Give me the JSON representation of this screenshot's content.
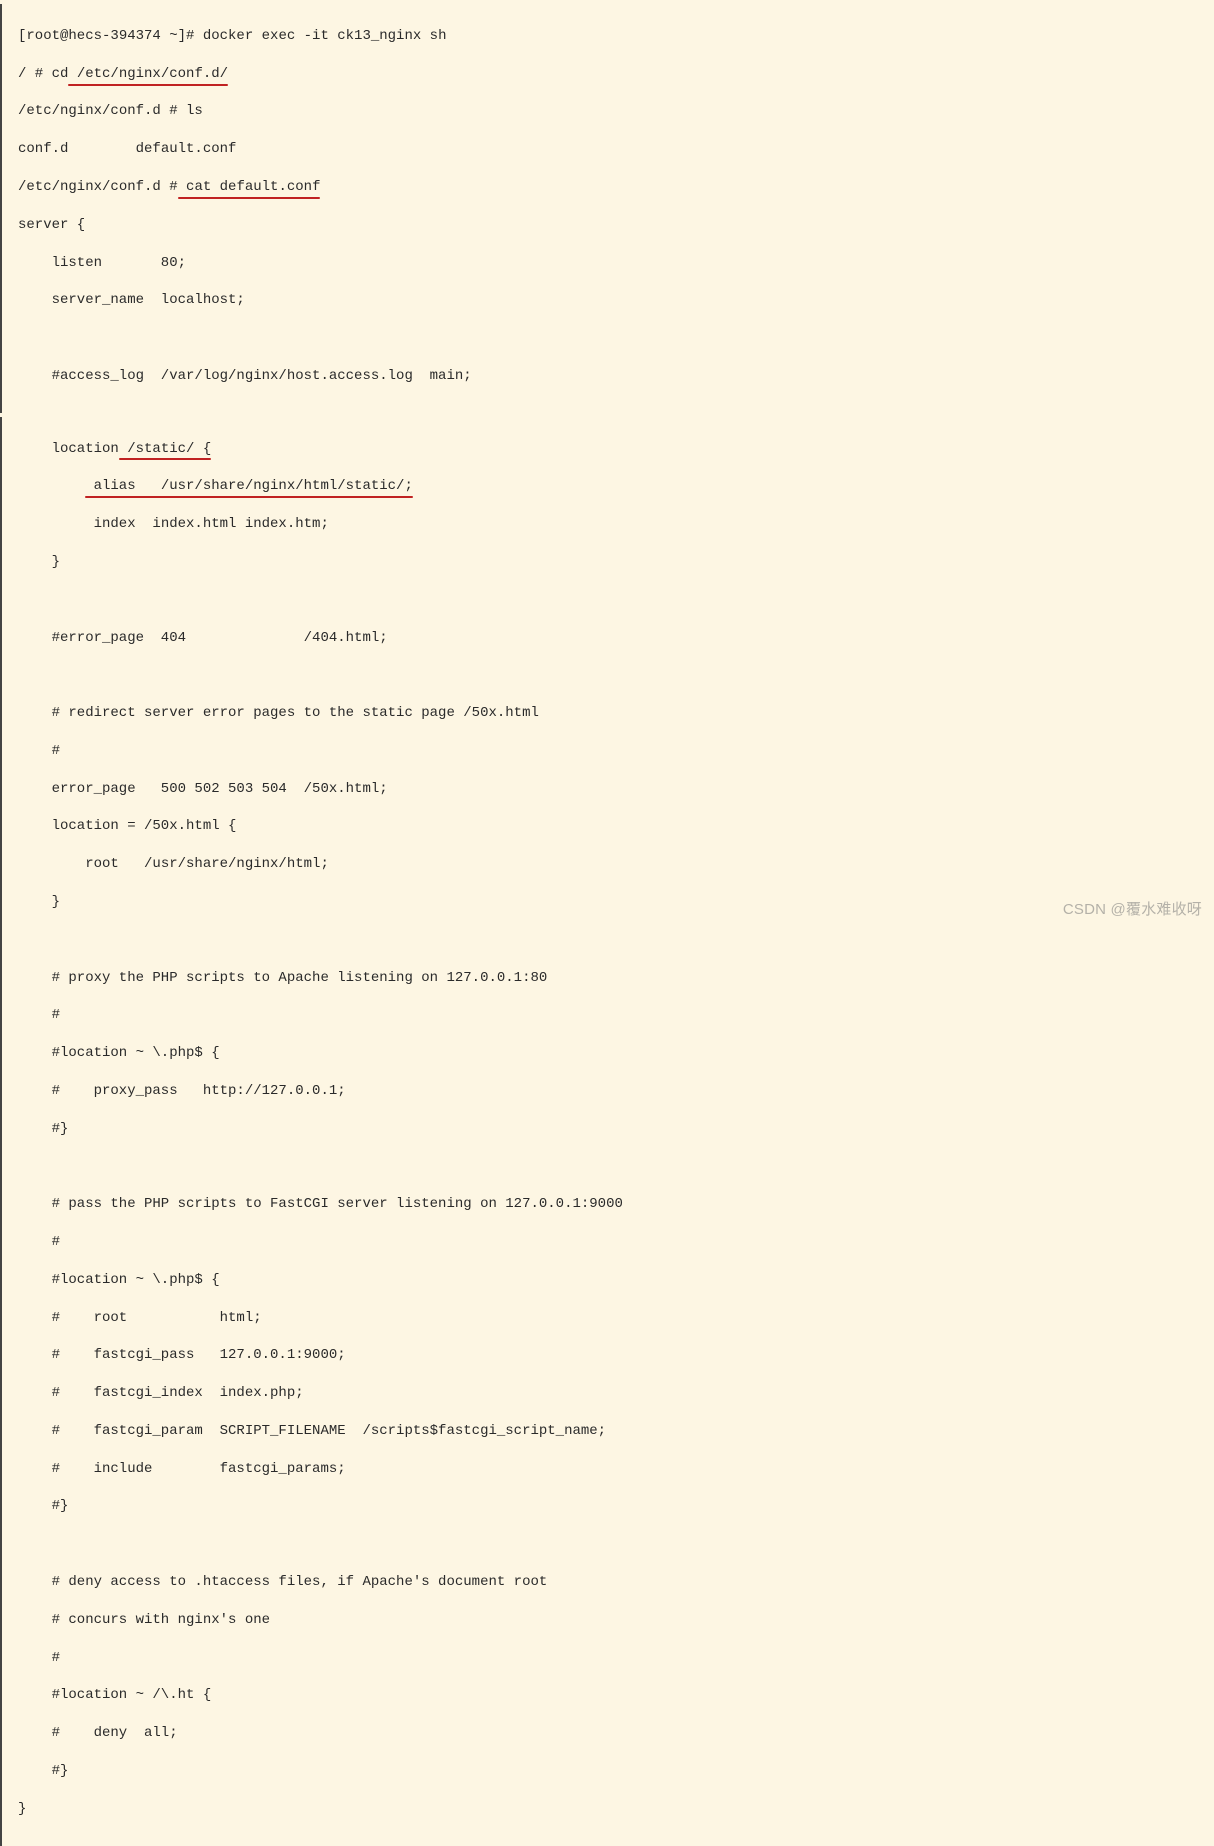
{
  "block1": {
    "l1": "[root@hecs-394374 ~]# docker exec -it ck13_nginx sh",
    "l2_pre": "/ # cd",
    "l2_ul": " /etc/nginx/conf.d/",
    "l3": "/etc/nginx/conf.d # ls",
    "l4": "conf.d        default.conf",
    "l5_pre": "/etc/nginx/conf.d #",
    "l5_ul": " cat default.conf",
    "l6": "server {",
    "l7": "listen       80;",
    "l8": "server_name  localhost;",
    "l9": "",
    "l10": "#access_log  /var/log/nginx/host.access.log  main;"
  },
  "block2": {
    "l1_pre": "location",
    "l1_ul": " /static/ {",
    "l2_ul": " alias   /usr/share/nginx/html/static/;",
    "l3": " index  index.html index.htm;",
    "l4": "}",
    "l5": "",
    "l6": "#error_page  404              /404.html;",
    "l7": "",
    "l8": "# redirect server error pages to the static page /50x.html",
    "l9": "#",
    "l10": "error_page   500 502 503 504  /50x.html;",
    "l11": "location = /50x.html {",
    "l12": "root   /usr/share/nginx/html;",
    "l13": "}",
    "l14": "",
    "l15": "# proxy the PHP scripts to Apache listening on 127.0.0.1:80",
    "l16": "#",
    "l17": "#location ~ \\.php$ {",
    "l18": "#    proxy_pass   http://127.0.0.1;",
    "l19": "#}",
    "l20": "",
    "l21": "# pass the PHP scripts to FastCGI server listening on 127.0.0.1:9000",
    "l22": "#",
    "l23": "#location ~ \\.php$ {",
    "l24": "#    root           html;",
    "l25": "#    fastcgi_pass   127.0.0.1:9000;",
    "l26": "#    fastcgi_index  index.php;",
    "l27": "#    fastcgi_param  SCRIPT_FILENAME  /scripts$fastcgi_script_name;",
    "l28": "#    include        fastcgi_params;",
    "l29": "#}",
    "l30": "",
    "l31": "# deny access to .htaccess files, if Apache's document root",
    "l32": "# concurs with nginx's one",
    "l33": "#",
    "l34": "#location ~ /\\.ht {",
    "l35": "#    deny  all;",
    "l36": "#}",
    "l37": "}"
  },
  "watermark": "CSDN @覆水难收呀"
}
